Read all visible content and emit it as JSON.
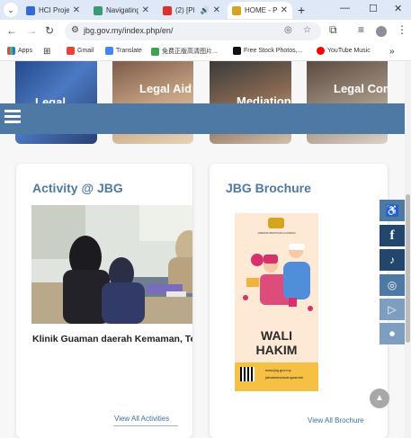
{
  "browser": {
    "tabs": [
      {
        "label": "HCI Projec",
        "favicon_color": "#2f6bd8"
      },
      {
        "label": "Navigating",
        "favicon_color": "#3a9b73"
      },
      {
        "label": "(2) [Pl",
        "favicon_color": "#e52d27"
      },
      {
        "label": "HOME - P",
        "favicon_color": "#d6a520",
        "active": true
      }
    ],
    "url": "jbg.gov.my/index.php/en/",
    "bookmarks": [
      {
        "label": "Apps"
      },
      {
        "label": ""
      },
      {
        "label": "Gmail"
      },
      {
        "label": "Translate"
      },
      {
        "label": "免费正版高清图片..."
      },
      {
        "label": "Free Stock Photos,..."
      },
      {
        "label": "YouTube Music"
      }
    ]
  },
  "services": [
    {
      "caption": "Legal"
    },
    {
      "caption": "Legal Aid"
    },
    {
      "caption": "Mediation"
    },
    {
      "caption": "Legal Companion"
    }
  ],
  "activity": {
    "title": "Activity @ JBG",
    "caption": "Klinik Guaman daerah Kemaman, Terengganu",
    "view_all": "View All Activities"
  },
  "brochure": {
    "title": "JBG Brochure",
    "headline_1": "WALI",
    "headline_2": "HAKIM",
    "top_text": "JABATAN BANTUAN GUAMAN",
    "footer_1": "www.jbg.gov.my",
    "footer_2": "jabatanbantuanguaman",
    "view_all": "View All Brochure"
  },
  "side_icons": [
    "accessibility-icon",
    "facebook-icon",
    "tiktok-icon",
    "instagram-icon",
    "youtube-icon",
    "video-icon"
  ],
  "colors": {
    "brand_blue": "#4d79a4",
    "dark_blue": "#23476c",
    "heading_blue": "#4d79a4"
  }
}
